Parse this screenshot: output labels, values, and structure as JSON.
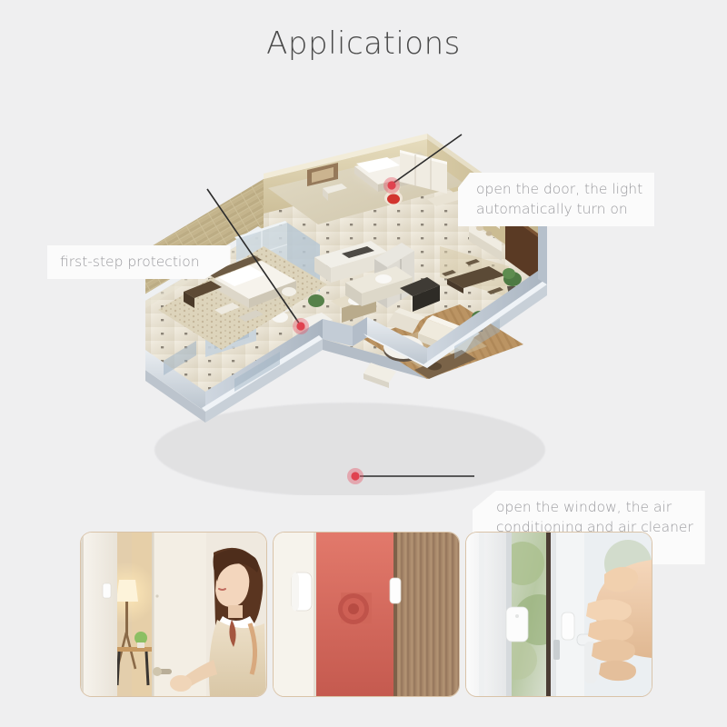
{
  "page": {
    "title": "Applications",
    "background_color": "#efeff0",
    "title_color": "#4a4a4a"
  },
  "callouts": [
    {
      "id": "first-step-protection",
      "text": "first-step protection",
      "position": "left",
      "text_color": "#9a9a9e",
      "box_color": "#fbfbfb"
    },
    {
      "id": "door-light",
      "text": "open the door, the light\nautomatically turn on",
      "position": "top-right",
      "text_color": "#9a9a9e",
      "box_color": "#fbfbfb"
    },
    {
      "id": "window-hvac",
      "text": "open the window, the air\nconditioning and air cleaner\nstop work temporarily",
      "position": "bottom-right",
      "text_color": "#9a9a9e",
      "box_color": "#fbfbfb"
    }
  ],
  "sensor_markers": [
    {
      "id": "marker-entry-door",
      "label": "entry door sensor",
      "color": "#e8596a"
    },
    {
      "id": "marker-interior",
      "label": "interior door sensor",
      "color": "#e8596a"
    },
    {
      "id": "marker-window",
      "label": "window sensor",
      "color": "#e8596a"
    }
  ],
  "floorplan": {
    "label": "isometric apartment cutaway",
    "rooms": [
      "bedroom",
      "bathroom",
      "kitchen",
      "entry hall",
      "dining area",
      "living room"
    ],
    "wall_color": "#cfd6de",
    "interior_wall_color": "#d9cfae",
    "floor_color": "#ece5d6"
  },
  "cards": [
    {
      "id": "card-door-woman",
      "caption": "woman opening white door with warm lamp light inside",
      "border_color": "#d9c3a8",
      "scene": "door-open-lamp"
    },
    {
      "id": "card-sensor-pair",
      "caption": "white door sensor pair on wooden door against coral wall",
      "border_color": "#d9c3a8",
      "scene": "sensor-on-door"
    },
    {
      "id": "card-window-hand",
      "caption": "hand opening white window handle with sensor on frame",
      "border_color": "#d9c3a8",
      "scene": "window-hand"
    }
  ]
}
